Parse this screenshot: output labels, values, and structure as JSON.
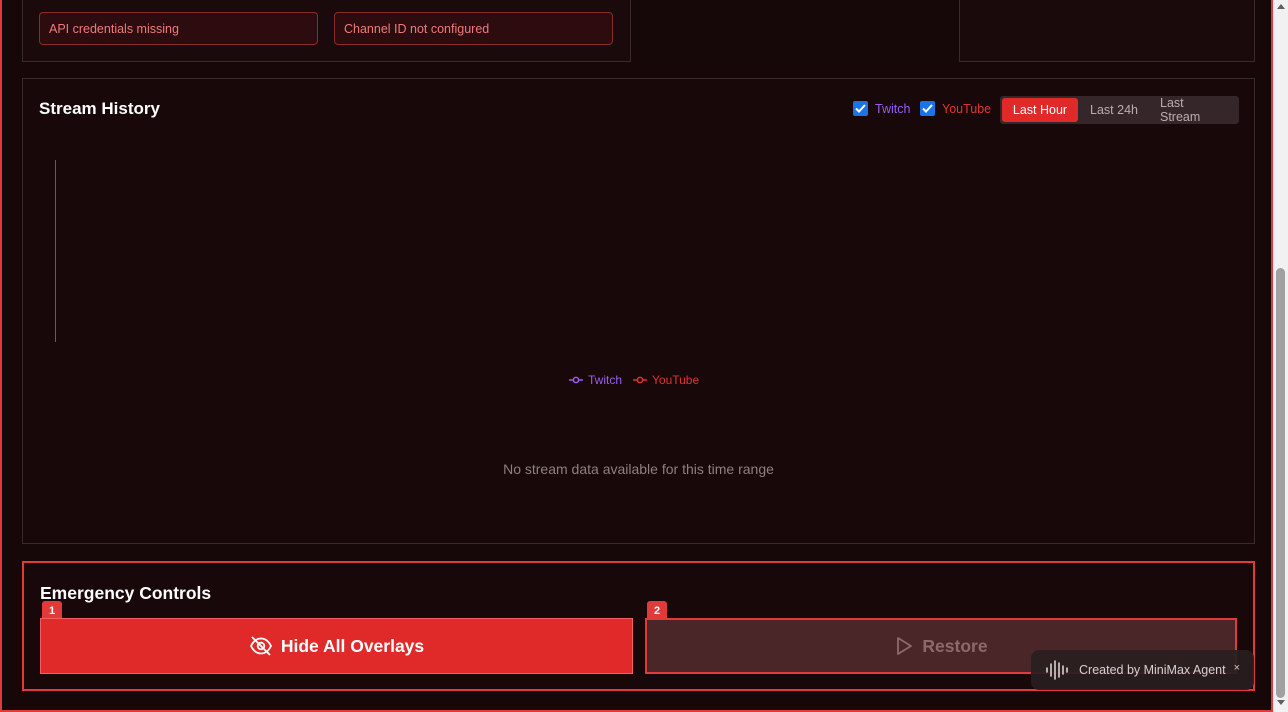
{
  "alerts": {
    "api_credentials": "API credentials missing",
    "channel_id": "Channel ID not configured"
  },
  "stream_history": {
    "title": "Stream History",
    "toggles": {
      "twitch": "Twitch",
      "youtube": "YouTube",
      "twitch_checked": true,
      "youtube_checked": true
    },
    "ranges": [
      "Last Hour",
      "Last 24h",
      "Last Stream"
    ],
    "active_range": "Last Hour",
    "legend": {
      "twitch": "Twitch",
      "youtube": "YouTube"
    },
    "empty_message": "No stream data available for this time range",
    "colors": {
      "twitch": "#9a5cf0",
      "youtube": "#e23333"
    }
  },
  "chart_data": {
    "type": "line",
    "series": [
      {
        "name": "Twitch",
        "values": []
      },
      {
        "name": "YouTube",
        "values": []
      }
    ],
    "legend_placement": "bottom-center",
    "grid": false
  },
  "emergency": {
    "title": "Emergency Controls",
    "hide_label": "Hide All Overlays",
    "hide_shortcut": "1",
    "restore_label": "Restore",
    "restore_shortcut": "2"
  },
  "badge": {
    "text": "Created by MiniMax Agent",
    "close": "×"
  },
  "icons": {
    "hide": "eye-off-icon",
    "restore": "play-icon",
    "badge": "waveform-icon"
  }
}
